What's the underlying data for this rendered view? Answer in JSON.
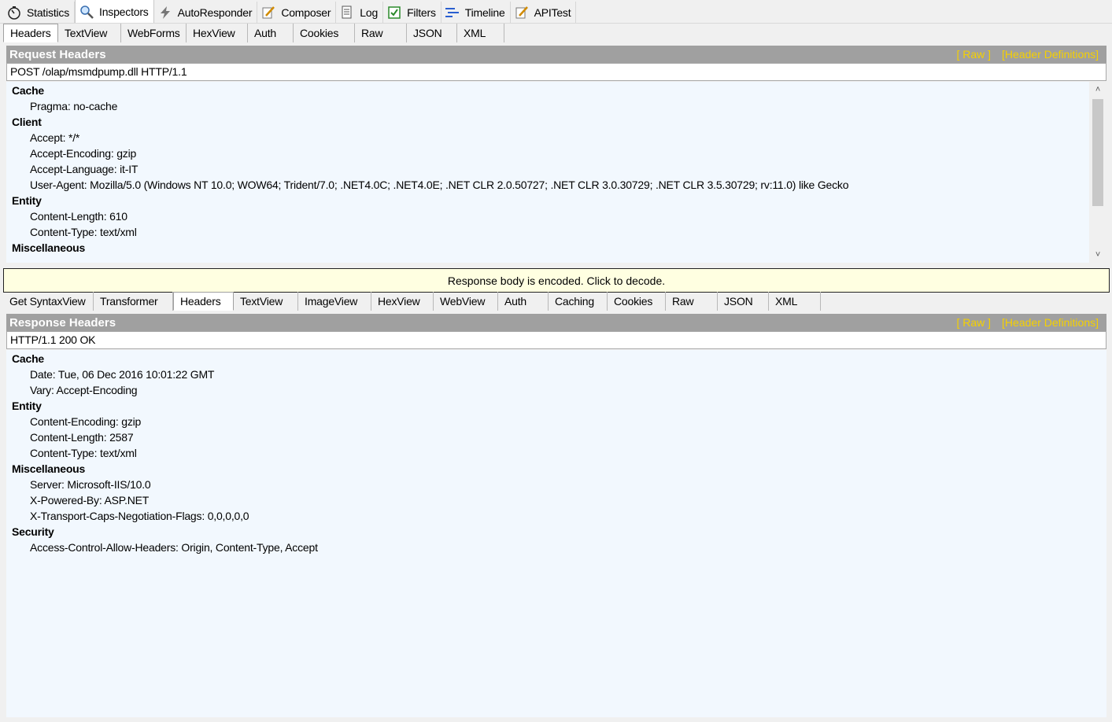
{
  "main_tabs": [
    {
      "label": "Statistics",
      "icon": "stopwatch-icon",
      "active": false
    },
    {
      "label": "Inspectors",
      "icon": "magnifier-icon",
      "active": true
    },
    {
      "label": "AutoResponder",
      "icon": "lightning-icon",
      "active": false
    },
    {
      "label": "Composer",
      "icon": "pencil-document-icon",
      "active": false
    },
    {
      "label": "Log",
      "icon": "document-icon",
      "active": false
    },
    {
      "label": "Filters",
      "icon": "checkbox-icon",
      "active": false
    },
    {
      "label": "Timeline",
      "icon": "timeline-icon",
      "active": false
    },
    {
      "label": "APITest",
      "icon": "pencil-document-icon",
      "active": false
    }
  ],
  "request": {
    "tabs": [
      "Headers",
      "TextView",
      "WebForms",
      "HexView",
      "Auth",
      "Cookies",
      "Raw",
      "JSON",
      "XML"
    ],
    "active_tab": "Headers",
    "title": "Request Headers",
    "raw_link": "[ Raw ]",
    "defs_link": "[Header Definitions]",
    "request_line": "POST /olap/msmdpump.dll HTTP/1.1",
    "groups": [
      {
        "name": "Cache",
        "items": [
          "Pragma: no-cache"
        ]
      },
      {
        "name": "Client",
        "items": [
          "Accept: */*",
          "Accept-Encoding: gzip",
          "Accept-Language: it-IT",
          "User-Agent: Mozilla/5.0 (Windows NT 10.0; WOW64; Trident/7.0; .NET4.0C; .NET4.0E; .NET CLR 2.0.50727; .NET CLR 3.0.30729; .NET CLR 3.5.30729; rv:11.0) like Gecko"
        ]
      },
      {
        "name": "Entity",
        "items": [
          "Content-Length: 610",
          "Content-Type: text/xml"
        ]
      },
      {
        "name": "Miscellaneous",
        "items": []
      }
    ]
  },
  "decode_message": "Response body is encoded. Click to decode.",
  "response": {
    "tabs": [
      "Get SyntaxView",
      "Transformer",
      "Headers",
      "TextView",
      "ImageView",
      "HexView",
      "WebView",
      "Auth",
      "Caching",
      "Cookies",
      "Raw",
      "JSON",
      "XML"
    ],
    "active_tab": "Headers",
    "title": "Response Headers",
    "raw_link": "[ Raw ]",
    "defs_link": "[Header Definitions]",
    "status_line": "HTTP/1.1 200 OK",
    "groups": [
      {
        "name": "Cache",
        "items": [
          "Date: Tue, 06 Dec 2016 10:01:22 GMT",
          "Vary: Accept-Encoding"
        ]
      },
      {
        "name": "Entity",
        "items": [
          "Content-Encoding: gzip",
          "Content-Length: 2587",
          "Content-Type: text/xml"
        ]
      },
      {
        "name": "Miscellaneous",
        "items": [
          "Server: Microsoft-IIS/10.0",
          "X-Powered-By: ASP.NET",
          "X-Transport-Caps-Negotiation-Flags: 0,0,0,0,0"
        ]
      },
      {
        "name": "Security",
        "items": [
          "Access-Control-Allow-Headers: Origin, Content-Type, Accept"
        ]
      }
    ]
  },
  "colors": {
    "header_bar": "#a0a0a0",
    "link": "#f5d000",
    "tree_bg": "#f2f8fe",
    "decode_bg": "#ffffe1"
  }
}
